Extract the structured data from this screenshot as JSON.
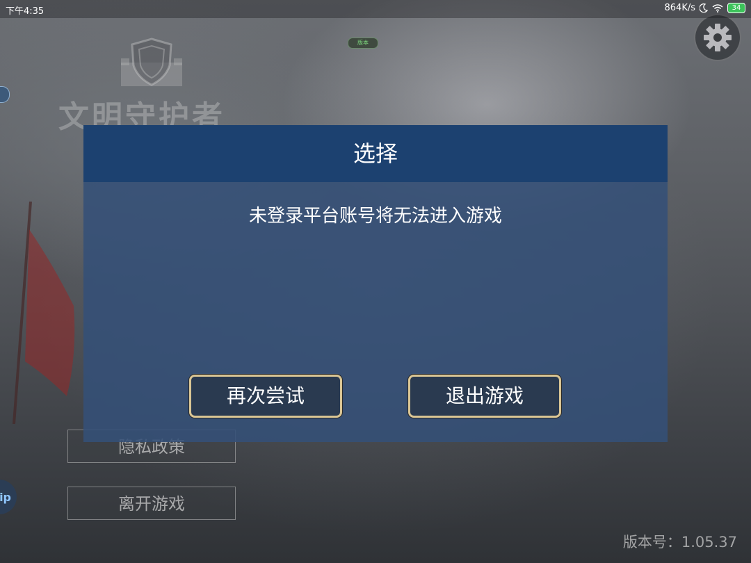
{
  "status_bar": {
    "time": "下午4:35",
    "network_speed": "864K/s",
    "battery_level": "34"
  },
  "background": {
    "game_title": "文明守护者",
    "badge_text": "版本",
    "menu_buttons": [
      {
        "label": "隐私政策"
      },
      {
        "label": "离开游戏"
      }
    ],
    "version_text": "版本号：1.05.37",
    "float_icon_text": "ip"
  },
  "dialog": {
    "title": "选择",
    "message": "未登录平台账号将无法进入游戏",
    "retry_label": "再次尝试",
    "exit_label": "退出游戏"
  },
  "colors": {
    "dialog_header": "#1c4170",
    "dialog_body": "#34507a",
    "button_border": "#d9c594",
    "button_fill": "#2a3a50"
  },
  "icons": {
    "settings": "gear-icon",
    "logo": "shield-castle-icon",
    "moon": "moon-icon",
    "wifi": "wifi-icon",
    "battery": "battery-icon"
  }
}
